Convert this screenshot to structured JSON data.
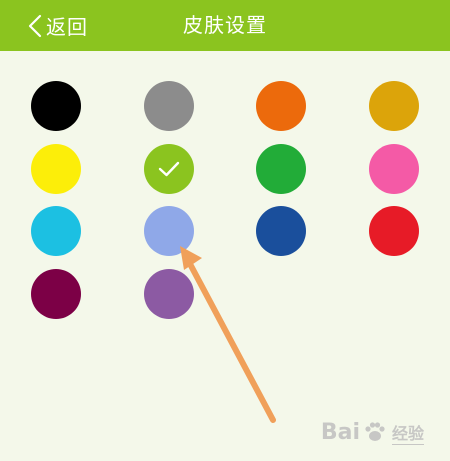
{
  "header": {
    "back_label": "返回",
    "title": "皮肤设置",
    "background": "#8bc41f"
  },
  "swatches": [
    {
      "color": "#000000",
      "selected": false
    },
    {
      "color": "#8c8c8c",
      "selected": false
    },
    {
      "color": "#ec6a0c",
      "selected": false
    },
    {
      "color": "#dca40a",
      "selected": false
    },
    {
      "color": "#fcee09",
      "selected": false
    },
    {
      "color": "#8bc41f",
      "selected": true
    },
    {
      "color": "#22ac38",
      "selected": false
    },
    {
      "color": "#f45aa6",
      "selected": false
    },
    {
      "color": "#1cc0e2",
      "selected": false
    },
    {
      "color": "#8fa8e8",
      "selected": false
    },
    {
      "color": "#1a4f9c",
      "selected": false
    },
    {
      "color": "#e71b27",
      "selected": false
    },
    {
      "color": "#7c0046",
      "selected": false
    },
    {
      "color": "#8c5aa3",
      "selected": false
    }
  ],
  "annotation": {
    "arrow_color": "#f0a05a"
  },
  "watermark": {
    "brand_a": "Bai",
    "brand_b": "经验"
  }
}
